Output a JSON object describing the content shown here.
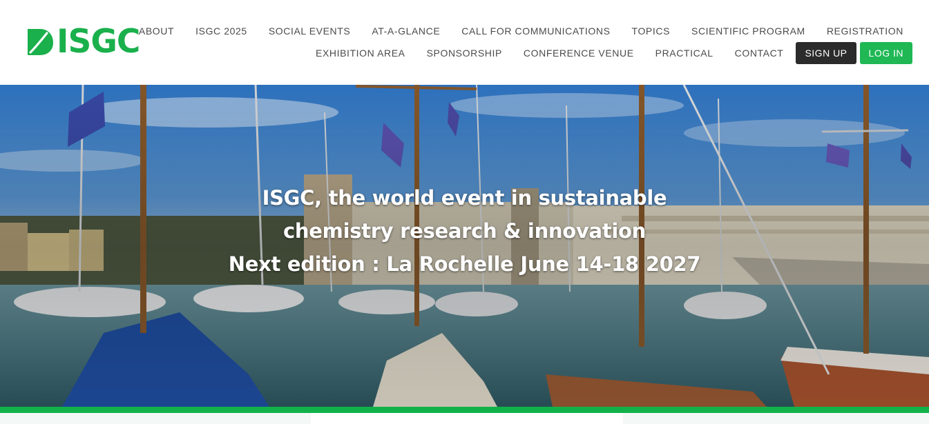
{
  "brand": {
    "name": "ISGC",
    "logo_icon": "leaf-icon",
    "color": "#1ab04c"
  },
  "nav": {
    "row1": [
      "ABOUT",
      "ISGC 2025",
      "SOCIAL EVENTS",
      "AT-A-GLANCE",
      "CALL FOR COMMUNICATIONS",
      "TOPICS",
      "SCIENTIFIC PROGRAM",
      "REGISTRATION"
    ],
    "row2": [
      "EXHIBITION AREA",
      "SPONSORSHIP",
      "CONFERENCE VENUE",
      "PRACTICAL",
      "CONTACT"
    ],
    "signup_label": "SIGN UP",
    "login_label": "LOG IN",
    "signup_color": "#2b2b2b",
    "login_color": "#1fb855"
  },
  "hero": {
    "line1": "ISGC, the world event in sustainable",
    "line2": "chemistry research & innovation",
    "line3": "Next edition : La Rochelle June 14-18 2027"
  },
  "accent_bar_color": "#12b24b"
}
